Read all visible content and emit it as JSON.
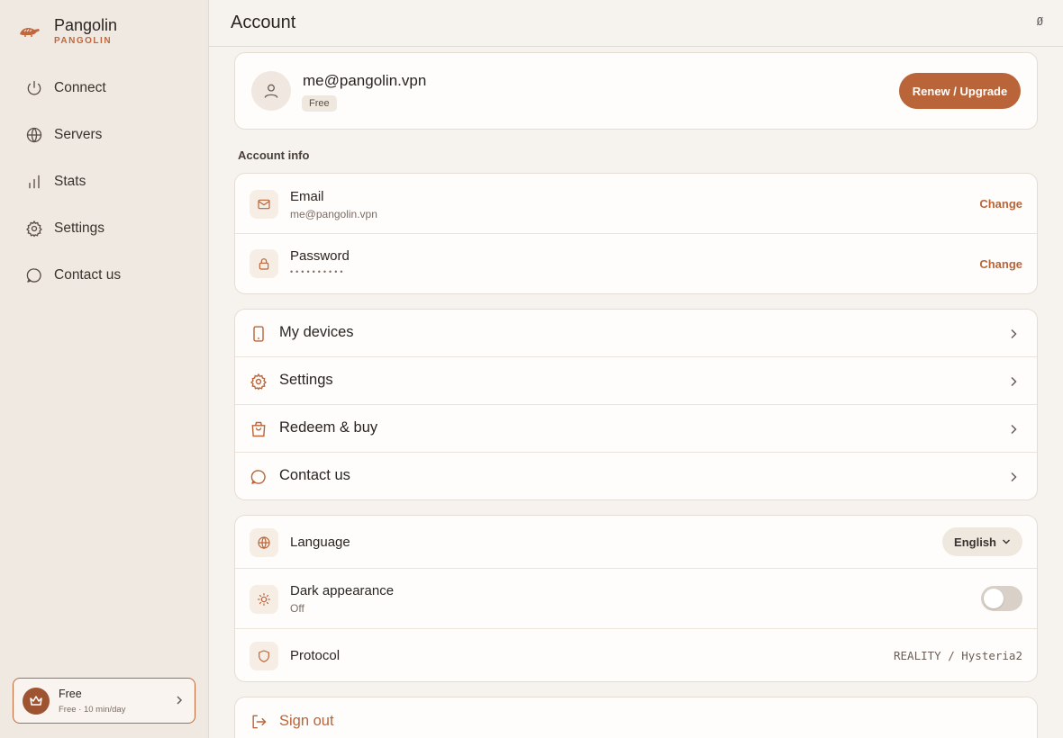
{
  "brand": {
    "name": "Pangolin",
    "subtitle": "PANGOLIN"
  },
  "nav": {
    "items": [
      {
        "label": "Connect",
        "icon": "power-icon"
      },
      {
        "label": "Servers",
        "icon": "globe-icon"
      },
      {
        "label": "Stats",
        "icon": "bar-chart-icon"
      },
      {
        "label": "Settings",
        "icon": "gear-icon"
      },
      {
        "label": "Contact us",
        "icon": "chat-bubble-icon"
      }
    ]
  },
  "plan_box": {
    "title": "Free",
    "subtitle": "Free · 10 min/day"
  },
  "header": {
    "title": "Account",
    "glyph": "Ø"
  },
  "profile": {
    "email": "me@pangolin.vpn",
    "plan": "Free",
    "renew_label": "Renew / Upgrade"
  },
  "account_info": {
    "label": "Account info",
    "email": {
      "title": "Email",
      "value": "me@pangolin.vpn",
      "action": "Change"
    },
    "password": {
      "title": "Password",
      "value": "••••••••••",
      "action": "Change"
    }
  },
  "links": [
    {
      "label": "My devices",
      "icon": "phone-icon"
    },
    {
      "label": "Settings",
      "icon": "gear-icon"
    },
    {
      "label": "Redeem & buy",
      "icon": "shopping-bag-icon"
    },
    {
      "label": "Contact us",
      "icon": "chat-bubble-icon"
    }
  ],
  "preferences": {
    "language": {
      "title": "Language",
      "value": "English"
    },
    "dark": {
      "title": "Dark appearance",
      "value": "Off",
      "enabled": false
    },
    "protocol": {
      "title": "Protocol",
      "value": "REALITY / Hysteria2"
    }
  },
  "signout": {
    "label": "Sign out"
  },
  "colors": {
    "accent": "#b96539",
    "sidebar_bg": "#efe9e2",
    "page_bg": "#f6f3ee"
  }
}
